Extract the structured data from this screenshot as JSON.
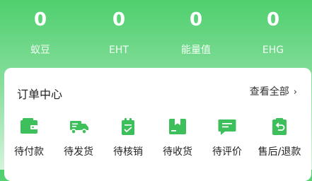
{
  "stats": [
    {
      "value": "0",
      "label": "蚁豆"
    },
    {
      "value": "0",
      "label": "EHT"
    },
    {
      "value": "0",
      "label": "能量值"
    },
    {
      "value": "0",
      "label": "EHG"
    }
  ],
  "order_center": {
    "title": "订单中心",
    "see_all": "查看全部",
    "chevron": "›",
    "items": [
      {
        "label": "待付款",
        "icon": "wallet-icon"
      },
      {
        "label": "待发货",
        "icon": "truck-icon"
      },
      {
        "label": "待核销",
        "icon": "clipboard-check-icon"
      },
      {
        "label": "待收货",
        "icon": "package-icon"
      },
      {
        "label": "待评价",
        "icon": "comment-icon"
      },
      {
        "label": "售后/退款",
        "icon": "refund-icon"
      }
    ]
  },
  "colors": {
    "accent": "#3dbf5b",
    "header_green": "#4fcf6e"
  }
}
